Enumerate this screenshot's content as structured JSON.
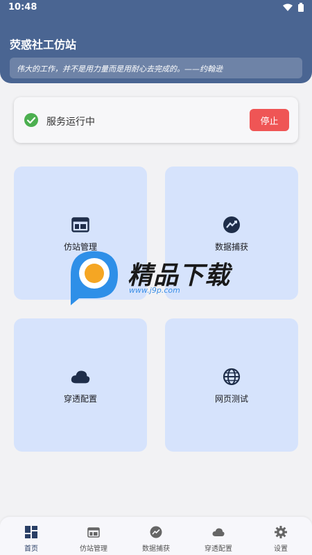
{
  "status_bar": {
    "time": "10:48"
  },
  "header": {
    "title": "荧惑社工仿站",
    "quote": "伟大的工作，并不是用力量而是用耐心去完成的。——约翰逊"
  },
  "service": {
    "status_text": "服务运行中",
    "stop_label": "停止",
    "status_color": "#4caf50"
  },
  "tiles": [
    {
      "label": "仿站管理",
      "icon": "web-window-icon"
    },
    {
      "label": "数据捕获",
      "icon": "chart-capture-icon"
    },
    {
      "label": "穿透配置",
      "icon": "cloud-icon"
    },
    {
      "label": "网页测试",
      "icon": "globe-icon"
    }
  ],
  "watermark": {
    "brand": "精品下载",
    "url": "www.j9p.com"
  },
  "bottom_nav": [
    {
      "label": "首页",
      "icon": "dashboard-icon",
      "active": true
    },
    {
      "label": "仿站管理",
      "icon": "web-window-icon"
    },
    {
      "label": "数据捕获",
      "icon": "chart-capture-icon"
    },
    {
      "label": "穿透配置",
      "icon": "cloud-icon"
    },
    {
      "label": "设置",
      "icon": "gear-icon"
    }
  ],
  "colors": {
    "header": "#4a6592",
    "tile": "#d6e3fc",
    "stop": "#ef5555",
    "icon": "#1f2e4a"
  }
}
